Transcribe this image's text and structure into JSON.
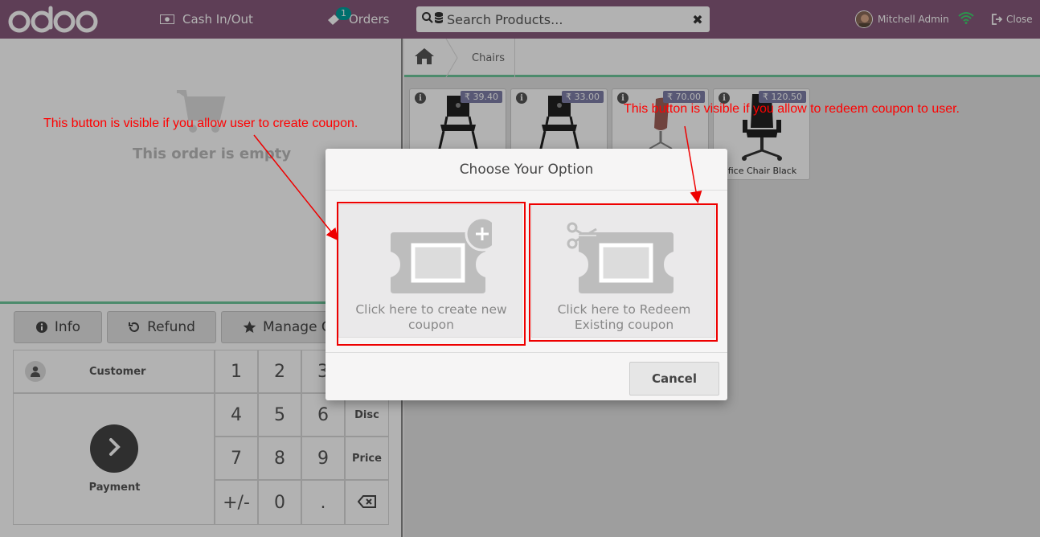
{
  "header": {
    "cash_label": "Cash In/Out",
    "orders_label": "Orders",
    "orders_badge": "1",
    "search_placeholder": "Search Products...",
    "user_name": "Mitchell Admin",
    "close_label": "Close"
  },
  "order": {
    "empty_text": "This order is empty"
  },
  "controls": {
    "info_label": "Info",
    "refund_label": "Refund",
    "manage_label": "Manage C"
  },
  "numpad": {
    "customer_label": "Customer",
    "payment_label": "Payment",
    "keys": [
      "1",
      "2",
      "3",
      "4",
      "5",
      "6",
      "Disc",
      "7",
      "8",
      "9",
      "Price",
      "+/-",
      "0",
      "."
    ]
  },
  "breadcrumb": {
    "category": "Chairs"
  },
  "products": [
    {
      "price": "₹ 39.40",
      "name": ""
    },
    {
      "price": "₹ 33.00",
      "name": ""
    },
    {
      "price": "₹ 70.00",
      "name": ""
    },
    {
      "price": "₹ 120.50",
      "name": "fice Chair Black"
    }
  ],
  "modal": {
    "title": "Choose Your Option",
    "create_label": "Click here to create new coupon",
    "redeem_label": "Click here to Redeem Existing coupon",
    "cancel_label": "Cancel"
  },
  "annotations": {
    "create_note": "This button is visible if you allow user to create coupon.",
    "redeem_note": "This button is visible if you allow to redeem coupon to user."
  },
  "colors": {
    "brand": "#875a7b",
    "accent_green": "#6ec89b",
    "badge": "#00a09d",
    "annotation": "#ee0000"
  }
}
